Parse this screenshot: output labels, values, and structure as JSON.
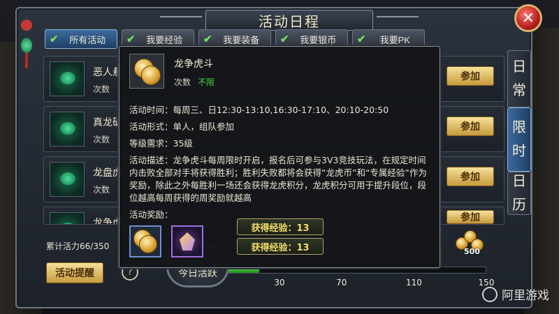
{
  "title": "活动日程",
  "tabs": [
    {
      "label": "所有活动",
      "active": true
    },
    {
      "label": "我要经验",
      "active": false
    },
    {
      "label": "我要装备",
      "active": false
    },
    {
      "label": "我要银币",
      "active": false
    },
    {
      "label": "我要PK",
      "active": false
    }
  ],
  "side_tabs": {
    "daily": [
      "日",
      "常"
    ],
    "schedule": [
      "限",
      "时"
    ],
    "calendar": [
      "日",
      "历"
    ]
  },
  "activities": [
    {
      "name": "恶人悬",
      "count_label": "次数",
      "join": "参加"
    },
    {
      "name": "真龙矿",
      "count_label": "次数",
      "join": "参加"
    },
    {
      "name": "龙盘虎",
      "count_label": "次数",
      "join": "参加"
    },
    {
      "name": "龙争虎",
      "count_label": "",
      "join": "参加"
    }
  ],
  "bottom": {
    "vitality": "累计活力66/350",
    "remind_button": "活动提醒",
    "help": "?",
    "today_label": "今日活跃",
    "progress_fraction": 0.12,
    "marks": [
      "30",
      "70",
      "110",
      "150"
    ],
    "coin_count": "500"
  },
  "popup": {
    "name": "龙争虎斗",
    "count_label": "次数",
    "count_value": "不限",
    "time": "活动时间：每周三、日12:30-13:10,16:30-17:10、20:10-20:50",
    "form": "活动形式：单人，组队参加",
    "level": "等级需求：35级",
    "desc": "活动描述：龙争虎斗每周限时开启，报名后可参与3V3竞技玩法，在规定时间内击败全部对手将获得胜利；胜利失败都将会获得“龙虎币”和“专属经验”作为奖励，除此之外每胜利一场还会获得龙虎积分，龙虎积分可用于提升段位，段位越高每周获得的周奖励就越高",
    "reward_label": "活动奖励：",
    "exp1": "获得经验：13",
    "exp2": "获得经验：13"
  },
  "watermark": "阿里游戏",
  "colors": {
    "accent_gold": "#c69a3d",
    "tab_active": "#3b6a9c",
    "unlimited_green": "#49d43d",
    "exp_yellow": "#f4de6a"
  }
}
